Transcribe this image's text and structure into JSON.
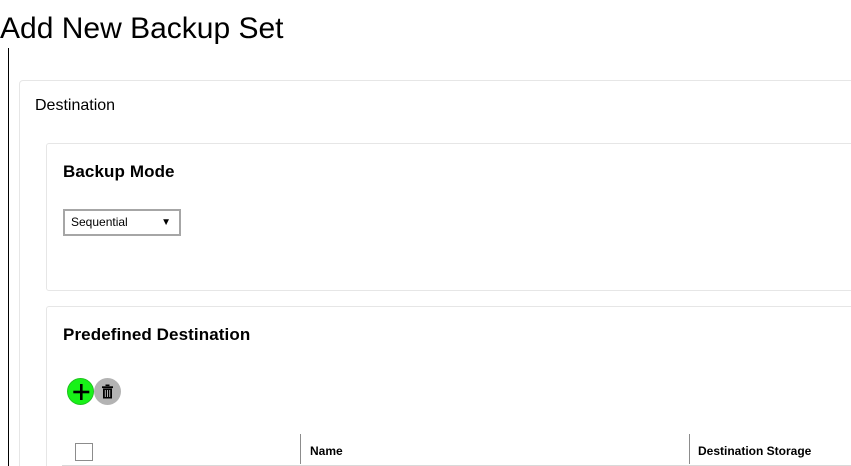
{
  "page": {
    "title": "Add New Backup Set"
  },
  "destination": {
    "section_title": "Destination",
    "backup_mode": {
      "heading": "Backup Mode",
      "selected": "Sequential",
      "caret": "▼"
    },
    "predefined": {
      "heading": "Predefined Destination",
      "add_icon": "plus-icon",
      "delete_icon": "trash-icon",
      "colors": {
        "add": "#18f218",
        "delete": "#b3b3b3"
      },
      "table": {
        "columns": [
          "Name",
          "Destination Storage"
        ]
      }
    }
  }
}
